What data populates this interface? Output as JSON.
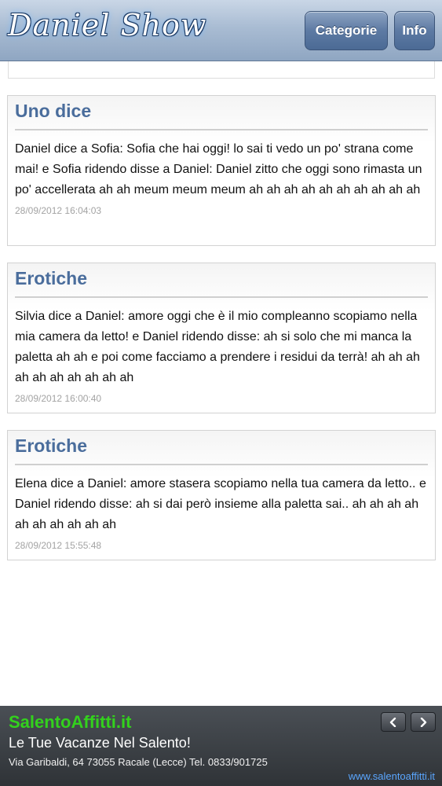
{
  "header": {
    "logo_text": "Daniel Show",
    "categorie_label": "Categorie",
    "info_label": "Info"
  },
  "posts": [
    {
      "category": "Uno dice",
      "text": "Daniel dice a Sofia: Sofia che hai oggi! lo sai ti vedo un po' strana come mai! e Sofia ridendo disse a Daniel: Daniel zitto che oggi sono rimasta un po' accellerata ah ah meum meum meum ah ah ah ah ah ah ah ah ah ah",
      "date": "28/09/2012 16:04:03"
    },
    {
      "category": "Erotiche",
      "text": "Silvia dice a Daniel: amore oggi che è il mio compleanno scopiamo nella mia camera da letto! e Daniel ridendo disse: ah si solo che mi manca la paletta ah ah e poi come facciamo a prendere i residui da terrà! ah ah ah ah ah ah ah ah ah ah",
      "date": "28/09/2012 16:00:40"
    },
    {
      "category": "Erotiche",
      "text": "Elena dice a Daniel: amore stasera scopiamo nella tua camera da letto.. e Daniel ridendo disse: ah si dai però insieme alla paletta sai.. ah ah ah ah ah ah ah ah ah ah",
      "date": "28/09/2012 15:55:48"
    }
  ],
  "ad": {
    "brand": "SalentoAffitti.it",
    "tagline": "Le Tue Vacanze Nel Salento!",
    "address": "Via Garibaldi, 64 73055 Racale (Lecce) Tel. 0833/901725",
    "url": "www.salentoaffitti.it",
    "prev_icon": "chevron-left-icon",
    "next_icon": "chevron-right-icon"
  },
  "colors": {
    "category_title": "#4a6d9c",
    "ad_brand": "#33d11d",
    "ad_url": "#5aa6ff"
  }
}
